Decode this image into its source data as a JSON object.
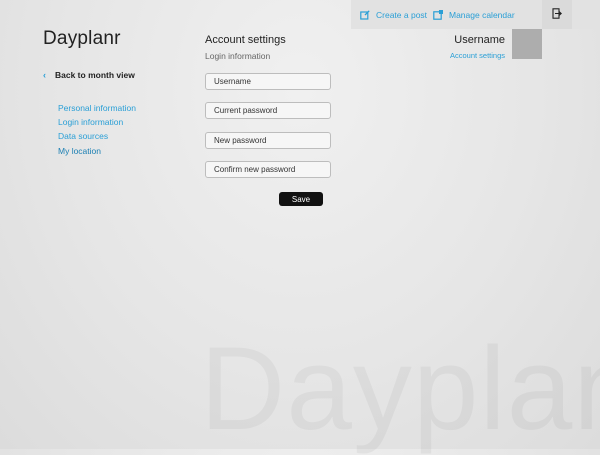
{
  "app": {
    "name": "Dayplanr",
    "watermark": "Dayplanr"
  },
  "topbar": {
    "create_post": {
      "label": "Create a post",
      "icon": "edit-square-icon"
    },
    "manage_calendar": {
      "label": "Manage calendar",
      "icon": "calendar-edit-icon"
    },
    "exit": {
      "icon": "logout-icon"
    }
  },
  "nav": {
    "back_label": "Back to month view",
    "items": [
      {
        "label": "Personal information"
      },
      {
        "label": "Login information"
      },
      {
        "label": "Data sources"
      },
      {
        "label": "My location"
      }
    ]
  },
  "main": {
    "title": "Account settings",
    "subtitle": "Login information",
    "fields": {
      "username": {
        "placeholder": "Username",
        "value": ""
      },
      "current_password": {
        "placeholder": "Current password",
        "value": ""
      },
      "new_password": {
        "placeholder": "New password",
        "value": ""
      },
      "confirm_password": {
        "placeholder": "Confirm new password",
        "value": ""
      }
    },
    "save_label": "Save"
  },
  "account": {
    "username": "Username",
    "settings_link": "Account settings"
  },
  "colors": {
    "accent": "#2a9fd6",
    "background": "#e6e6e6",
    "avatar": "#adadad",
    "button": "#111111"
  }
}
